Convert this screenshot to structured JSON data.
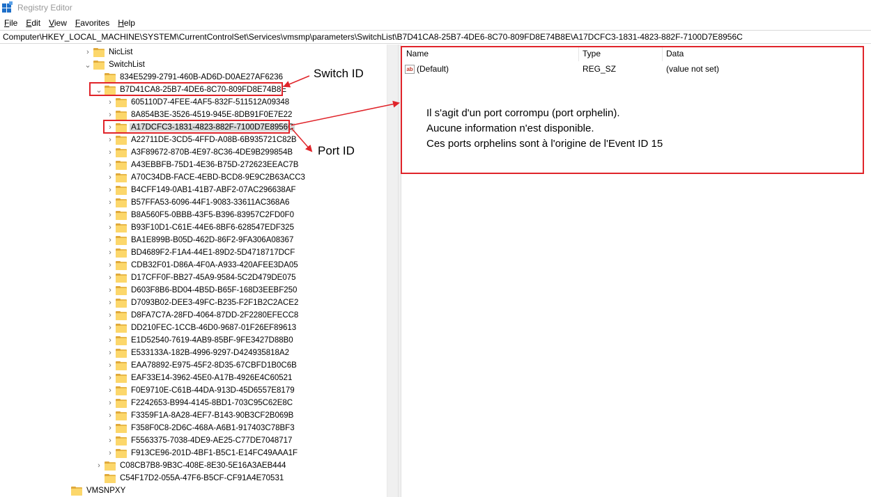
{
  "window": {
    "title": "Registry Editor"
  },
  "menu": [
    {
      "first": "F",
      "rest": "ile"
    },
    {
      "first": "E",
      "rest": "dit"
    },
    {
      "first": "V",
      "rest": "iew"
    },
    {
      "first": "F",
      "rest": "avorites"
    },
    {
      "first": "H",
      "rest": "elp"
    }
  ],
  "address": "Computer\\HKEY_LOCAL_MACHINE\\SYSTEM\\CurrentControlSet\\Services\\vmsmp\\parameters\\SwitchList\\B7D41CA8-25B7-4DE6-8C70-809FD8E74B8E\\A17DCFC3-1831-4823-882F-7100D7E8956C",
  "tree": {
    "niclist": "NicList",
    "switchlist": "SwitchList",
    "switch_sibling": "834E5299-2791-460B-AD6D-D0AE27AF6236",
    "switch_selected": "B7D41CA8-25B7-4DE6-8C70-809FD8E74B8E",
    "ports": [
      "605110D7-4FEE-4AF5-832F-511512A09348",
      "8A854B3E-3526-4519-945E-8DB91F0E7E22",
      "A17DCFC3-1831-4823-882F-7100D7E8956C",
      "A22711DE-3CD5-4FFD-A08B-6B935721C82B",
      "A3F89672-870B-4E97-8C36-4DE9B299854B",
      "A43EBBFB-75D1-4E36-B75D-272623EEAC7B",
      "A70C34DB-FACE-4EBD-BCD8-9E9C2B63ACC3",
      "B4CFF149-0AB1-41B7-ABF2-07AC296638AF",
      "B57FFA53-6096-44F1-9083-33611AC368A6",
      "B8A560F5-0BBB-43F5-B396-83957C2FD0F0",
      "B93F10D1-C61E-44E6-8BF6-628547EDF325",
      "BA1E899B-B05D-462D-86F2-9FA306A08367",
      "BD4689F2-F1A4-44E1-89D2-5D4718717DCF",
      "CDB32F01-D86A-4F0A-A933-420AFEE3DA05",
      "D17CFF0F-BB27-45A9-9584-5C2D479DE075",
      "D603F8B6-BD04-4B5D-B65F-168D3EEBF250",
      "D7093B02-DEE3-49FC-B235-F2F1B2C2ACE2",
      "D8FA7C7A-28FD-4064-87DD-2F2280EFECC8",
      "DD210FEC-1CCB-46D0-9687-01F26EF89613",
      "E1D52540-7619-4AB9-85BF-9FE3427D88B0",
      "E533133A-182B-4996-9297-D424935818A2",
      "EAA78892-E975-45F2-8D35-67CBFD1B0C6B",
      "EAF33E14-3962-45E0-A17B-4926E4C60521",
      "F0E9710E-C61B-44DA-913D-45D6557E8179",
      "F2242653-B994-4145-8BD1-703C95C62E8C",
      "F3359F1A-8A28-4EF7-B143-90B3CF2B069B",
      "F358F0C8-2D6C-468A-A6B1-917403C78BF3",
      "F5563375-7038-4DE9-AE25-C77DE7048717",
      "F913CE96-201D-4BF1-B5C1-E14FC49AAA1F"
    ],
    "switch_after_1": "C08CB7B8-9B3C-408E-8E30-5E16A3AEB444",
    "switch_after_2": "C54F17D2-055A-47F6-B5CF-CF91A4E70531",
    "vmsnpxy": "VMSNPXY"
  },
  "columns": {
    "name": "Name",
    "type": "Type",
    "data": "Data"
  },
  "values": [
    {
      "icon": "string-value-icon",
      "name": "(Default)",
      "type": "REG_SZ",
      "data": "(value not set)"
    }
  ],
  "annotations": {
    "switch_id_label": "Switch ID",
    "port_id_label": "Port ID",
    "note_lines": [
      "Il s'agit d'un port corrompu (port orphelin).",
      "Aucune information n'est disponible.",
      "Ces ports orphelins sont à l'origine de l'Event ID 15"
    ],
    "color": "#e0242a"
  },
  "colors": {
    "folder": "#fcd76b",
    "selection": "#d9d9d9",
    "accent": "#1e6fc9"
  }
}
